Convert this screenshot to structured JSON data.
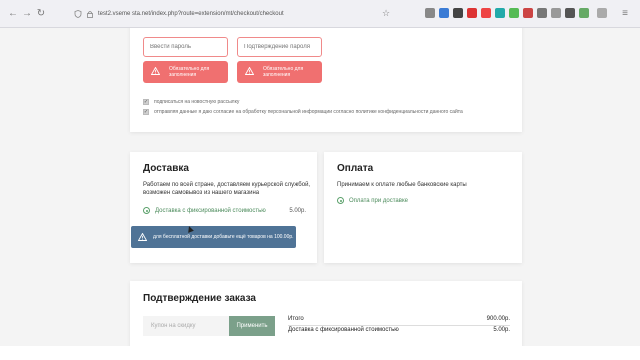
{
  "browser": {
    "back_icon": "arrow-left-icon",
    "forward_icon": "arrow-right-icon",
    "reload_icon": "reload-icon",
    "url": "test2.vseme sta.net/index.php?route=extension/mt/checkout/checkout"
  },
  "registration": {
    "password_placeholder": "Ввести пароль",
    "confirm_placeholder": "Подтверждение пароля",
    "error_text": "Обязательно для заполнения",
    "newsletter_label": "подписаться на новостную рассылку",
    "consent_label": "отправляя данные я даю согласие на обработку персональной информации согласно политике конфиденциальности данного сайта"
  },
  "delivery": {
    "title": "Доставка",
    "description": "Работаем по всей стране, доставляем курьерской службой, возможен самовывоз из нашего магазина",
    "option_label": "Доставка с фиксированной стоимостью",
    "option_price": "5.00р.",
    "notice": "для бесплатной доставки добавьте ещё товаров на 100.00р."
  },
  "payment": {
    "title": "Оплата",
    "description": "Принимаем к оплате любые банковские карты",
    "option_label": "Оплата при доставке"
  },
  "confirm": {
    "title": "Подтверждение заказа",
    "coupon_placeholder": "Купон на скидку",
    "apply_label": "Применить",
    "rows": [
      {
        "label": "Итого",
        "value": "900.00р."
      },
      {
        "label": "Доставка с фиксированной стоимостью",
        "value": "5.00р."
      }
    ]
  },
  "colors": {
    "error": "#f07070",
    "info": "#4f7396",
    "accent_green": "#7ba08a"
  }
}
